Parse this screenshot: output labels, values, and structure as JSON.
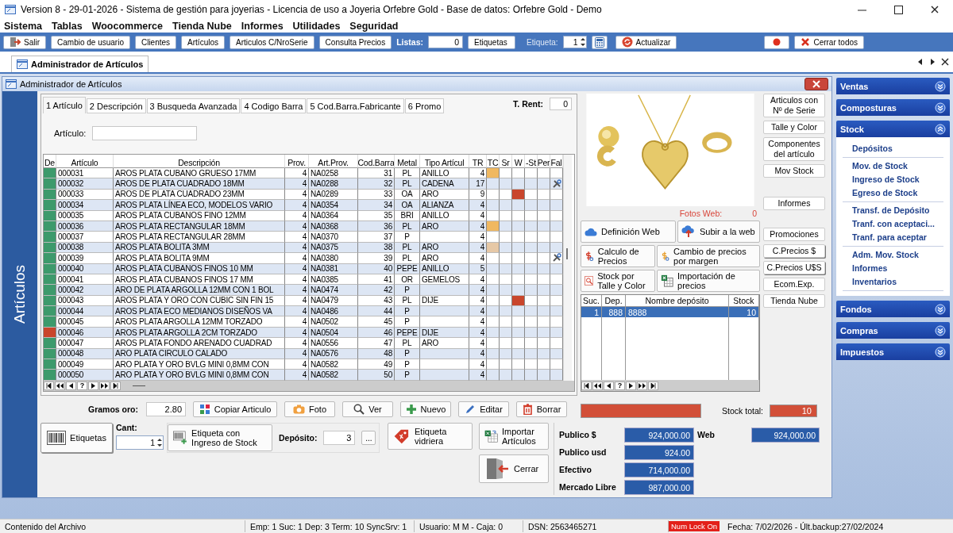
{
  "window": {
    "title": "Version 8 - 29-01-2026 - Sistema de gestión para joyerias - Licencia de uso a Joyeria Orfebre Gold - Base de datos: Orfebre Gold - Demo"
  },
  "menu": [
    "Sistema",
    "Tablas",
    "Woocommerce",
    "Tienda Nube",
    "Informes",
    "Utilidades",
    "Seguridad"
  ],
  "toolbar": {
    "buttons": [
      {
        "kind": "exit",
        "label": "Salir"
      },
      {
        "kind": "plain",
        "label": "Cambio de usuario"
      },
      {
        "kind": "plain",
        "label": "Clientes"
      },
      {
        "kind": "plain",
        "label": "Artículos"
      },
      {
        "kind": "plain",
        "label": "Articulos C/NroSerie"
      },
      {
        "kind": "plain",
        "label": "Consulta Precios"
      }
    ],
    "listas_label": "Listas:",
    "listas_value": "0",
    "etiquetas": "Etiquetas",
    "etiqueta_label": "Etiqueta:",
    "etiqueta_value": "1",
    "actualizar": "Actualizar",
    "cerrar_todos": "Cerrar todos"
  },
  "doc_tabs": [
    {
      "label": "Administrador de Artículos",
      "selected": true
    }
  ],
  "child_window": {
    "title": "Administrador de Artículos",
    "side_label": "Artículos"
  },
  "tabs": [
    {
      "label": "1 Artículo",
      "selected": true
    },
    {
      "label": "2 Descripción",
      "selected": false
    },
    {
      "label": "3 Busqueda Avanzada",
      "selected": false
    },
    {
      "label": "4 Codigo Barra",
      "selected": false
    },
    {
      "label": "5 Cod.Barra.Fabricante",
      "selected": false
    },
    {
      "label": "6 Promo",
      "selected": false
    }
  ],
  "t_rent": {
    "label": "T. Rent:",
    "value": "0"
  },
  "articulo_field": {
    "label": "Artículo:"
  },
  "grid": {
    "columns": [
      "De",
      "Artículo",
      "Descripción",
      "Prov.",
      "Art.Prov.",
      "Cod.Barra",
      "Metal",
      "Tipo Artícul",
      "TR",
      "TC",
      "Sr",
      "W",
      "-St",
      "Per",
      "Fal"
    ],
    "rows": [
      {
        "articulo": "000031",
        "descripcion": "AROS PLATA CUBANO GRUESO 17MM",
        "prov": "4",
        "art_prov": "NA0258",
        "cod_barra": "31",
        "metal": "PL",
        "tipo": "ANILLO",
        "tr": "4",
        "color": "#3d9a6c",
        "tc": {
          "color": "#f0b860"
        },
        "w": false,
        "tool": false
      },
      {
        "articulo": "000032",
        "descripcion": "AROS DE PLATA CUADRADO 18MM",
        "prov": "4",
        "art_prov": "NA0288",
        "cod_barra": "32",
        "metal": "PL",
        "tipo": "CADENA",
        "tr": "17",
        "color": "#3d9a6c",
        "w": false,
        "tool": true
      },
      {
        "articulo": "000033",
        "descripcion": "AROS DE PLATA CUADRADO 23MM",
        "prov": "4",
        "art_prov": "NA0289",
        "cod_barra": "33",
        "metal": "OA",
        "tipo": "ARO",
        "tr": "9",
        "color": "#3d9a6c",
        "w": true,
        "tool": false
      },
      {
        "articulo": "000034",
        "descripcion": "AROS PLATA LÍNEA ECO, MODELOS VARIO",
        "prov": "4",
        "art_prov": "NA0354",
        "cod_barra": "34",
        "metal": "OA",
        "tipo": "ALIANZA",
        "tr": "4",
        "color": "#3d9a6c",
        "w": false,
        "tool": false
      },
      {
        "articulo": "000035",
        "descripcion": "AROS PLATA CUBANOS FINO 12MM",
        "prov": "4",
        "art_prov": "NA0364",
        "cod_barra": "35",
        "metal": "BRI",
        "tipo": "ANILLO",
        "tr": "4",
        "color": "#3d9a6c",
        "w": false,
        "tool": false
      },
      {
        "articulo": "000036",
        "descripcion": "AROS PLATA RECTANGULAR 18MM",
        "prov": "4",
        "art_prov": "NA0368",
        "cod_barra": "36",
        "metal": "PL",
        "tipo": "ARO",
        "tr": "4",
        "color": "#3d9a6c",
        "tc": {
          "color": "#f0b860"
        },
        "w": false,
        "tool": false
      },
      {
        "articulo": "000037",
        "descripcion": "AROS PLATA RECTANGULAR 28MM",
        "prov": "4",
        "art_prov": "NA0370",
        "cod_barra": "37",
        "metal": "P",
        "tr": "4",
        "color": "#3d9a6c",
        "w": false,
        "tool": false
      },
      {
        "articulo": "000038",
        "descripcion": "AROS PLATA BOLITA 3MM",
        "prov": "4",
        "art_prov": "NA0375",
        "cod_barra": "38",
        "metal": "PL",
        "tipo": "ARO",
        "tr": "4",
        "color": "#3d9a6c",
        "tc": {
          "color": "#e6c8a6"
        },
        "w": false,
        "tool": false
      },
      {
        "articulo": "000039",
        "descripcion": "AROS PLATA BOLITA 9MM",
        "prov": "4",
        "art_prov": "NA0380",
        "cod_barra": "39",
        "metal": "PL",
        "tipo": "ARO",
        "tr": "4",
        "color": "#3d9a6c",
        "w": false,
        "tool": true
      },
      {
        "articulo": "000040",
        "descripcion": "AROS PLATA CUBANOS FINOS 10 MM",
        "prov": "4",
        "art_prov": "NA0381",
        "cod_barra": "40",
        "metal": "PEPE",
        "tipo": "ANILLO",
        "tr": "5",
        "color": "#3d9a6c",
        "w": false,
        "tool": false
      },
      {
        "articulo": "000041",
        "descripcion": "AROS PLATA CUBANOS FINOS 17 MM",
        "prov": "4",
        "art_prov": "NA0385",
        "cod_barra": "41",
        "metal": "OR",
        "tipo": "GEMELOS",
        "tr": "4",
        "color": "#3d9a6c",
        "w": false,
        "tool": false
      },
      {
        "articulo": "000042",
        "descripcion": "ARO DE PLATA ARGOLLA 12MM CON 1 BOL",
        "prov": "4",
        "art_prov": "NA0474",
        "cod_barra": "42",
        "metal": "P",
        "tr": "4",
        "color": "#3d9a6c",
        "w": false,
        "tool": false
      },
      {
        "articulo": "000043",
        "descripcion": "AROS PLATA Y ORO CON CUBIC SIN FIN 15",
        "prov": "4",
        "art_prov": "NA0479",
        "cod_barra": "43",
        "metal": "PL",
        "tipo": "DIJE",
        "tr": "4",
        "color": "#3d9a6c",
        "w": true,
        "tool": false
      },
      {
        "articulo": "000044",
        "descripcion": "AROS PLATA ECO MEDIANOS DISEÑOS VA",
        "prov": "4",
        "art_prov": "NA0486",
        "cod_barra": "44",
        "metal": "P",
        "tr": "4",
        "color": "#3d9a6c",
        "w": false,
        "tool": false
      },
      {
        "articulo": "000045",
        "descripcion": "AROS PLATA ARGOLLA 12MM TORZADO",
        "prov": "4",
        "art_prov": "NA0502",
        "cod_barra": "45",
        "metal": "P",
        "tr": "4",
        "color": "#3d9a6c",
        "w": false,
        "tool": false
      },
      {
        "articulo": "000046",
        "descripcion": "AROS PLATA ARGOLLA 2CM TORZADO",
        "prov": "4",
        "art_prov": "NA0504",
        "cod_barra": "46",
        "metal": "PEPE",
        "tipo": "DIJE",
        "tr": "4",
        "color": "#c9462c",
        "w": false,
        "tool": false
      },
      {
        "articulo": "000047",
        "descripcion": "AROS PLATA FONDO ARENADO CUADRAD",
        "prov": "4",
        "art_prov": "NA0556",
        "cod_barra": "47",
        "metal": "PL",
        "tipo": "ARO",
        "tr": "4",
        "color": "#3d9a6c",
        "w": false,
        "tool": false
      },
      {
        "articulo": "000048",
        "descripcion": "ARO PLATA CIRCULO CALADO",
        "prov": "4",
        "art_prov": "NA0576",
        "cod_barra": "48",
        "metal": "P",
        "tr": "4",
        "color": "#3d9a6c",
        "w": false,
        "tool": false
      },
      {
        "articulo": "000049",
        "descripcion": "ARO PLATA Y ORO BVLG MINI 0,8MM CON",
        "prov": "4",
        "art_prov": "NA0582",
        "cod_barra": "49",
        "metal": "P",
        "tr": "4",
        "color": "#3d9a6c",
        "w": false,
        "tool": false
      },
      {
        "articulo": "000050",
        "descripcion": "ARO PLATA Y ORO BVLG MINI 0,8MM CON",
        "prov": "4",
        "art_prov": "NA0582",
        "cod_barra": "50",
        "metal": "P",
        "tr": "4",
        "color": "#3d9a6c",
        "w": false,
        "tool": false
      }
    ],
    "nav_label": "?"
  },
  "gramos": {
    "label": "Gramos oro:",
    "value": "2.80"
  },
  "actions": [
    {
      "kind": "copy",
      "label": "Copiar Articulo"
    },
    {
      "label": "Foto"
    },
    {
      "kind": "view",
      "label": "Ver"
    },
    {
      "kind": "new",
      "label": "Nuevo"
    },
    {
      "kind": "edit",
      "label": "Editar"
    },
    {
      "kind": "delete",
      "label": "Borrar"
    }
  ],
  "bottom": {
    "etiquetas": "Etiquetas",
    "cant_label": "Cant:",
    "cant_value": "1",
    "etiqueta_ingreso": "Etiqueta con Ingreso de Stock",
    "deposito_label": "Depósito:",
    "deposito_value": "3",
    "more": "...",
    "vidriera": "Etiqueta vidriera",
    "importar": "Importar Artículos",
    "cerrar": "Cerrar"
  },
  "side_buttons": [
    "Articulos con Nº de Serie",
    "Talle y Color",
    "Componentes del artículo",
    "Mov  Stock",
    "Informes",
    "Promociones",
    "C.Precios $",
    "C.Precios U$S",
    "Ecom.Exp.",
    "Tienda Nube"
  ],
  "fotos_web": {
    "label": "Fotos Web:",
    "value": "0"
  },
  "web_buttons": [
    {
      "kind": "cloud",
      "label": "Definición Web"
    },
    {
      "kind": "upload",
      "label": "Subir a la web"
    },
    {
      "kind": "calc",
      "label": "Calculo de Precios"
    },
    {
      "kind": "margin",
      "label": "Cambio de precios por margen"
    },
    {
      "kind": "stock",
      "label": "Stock por Talle y Color"
    },
    {
      "kind": "excel",
      "label": "Importación de precios"
    }
  ],
  "stock_table": {
    "columns": [
      "Suc.",
      "Dep.",
      "Nombre depósito",
      "Stock"
    ],
    "rows": [
      {
        "suc": "1",
        "dep": "888",
        "nombre": "8888",
        "stock": "10",
        "selected": true
      }
    ],
    "nav_label": "?"
  },
  "stock_total": {
    "label": "Stock total:",
    "value": "10"
  },
  "prices": [
    {
      "label": "Publico $",
      "value": "924,000.00"
    },
    {
      "label": "Publico usd",
      "value": "924.00"
    },
    {
      "label": "Efectivo",
      "value": "714,000.00"
    },
    {
      "label": "Mercado Libre",
      "value": "987,000.00"
    }
  ],
  "web_price": {
    "label": "Web",
    "value": "924,000.00"
  },
  "sidebar": {
    "groups": [
      {
        "label": "Ventas",
        "expanded": false
      },
      {
        "label": "Composturas",
        "expanded": false
      },
      {
        "label": "Stock",
        "expanded": true,
        "sections": [
          {
            "items": [
              "Depósitos"
            ]
          },
          {
            "items": [
              "Mov. de Stock",
              "Ingreso de Stock",
              "Egreso de Stock"
            ]
          },
          {
            "items": [
              "Transf. de Depósito",
              "Tranf. con aceptaci...",
              "Tranf. para aceptar"
            ]
          },
          {
            "items": [
              "Adm. Mov. Stock",
              "Informes",
              "Inventarios"
            ]
          }
        ]
      },
      {
        "label": "Fondos",
        "expanded": false
      },
      {
        "label": "Compras",
        "expanded": false
      },
      {
        "label": "Impuestos",
        "expanded": false
      }
    ]
  },
  "status_bar": [
    "Contenido del Archivo",
    "Emp: 1 Suc: 1 Dep: 3 Term: 10 SyncSrv: 1",
    "Usuario: M M - Caja: 0",
    "DSN: 2563465271",
    "Fecha: 7/02/2026 - Últ.backup:27/02/2024"
  ],
  "num_lock": "Num Lock On"
}
